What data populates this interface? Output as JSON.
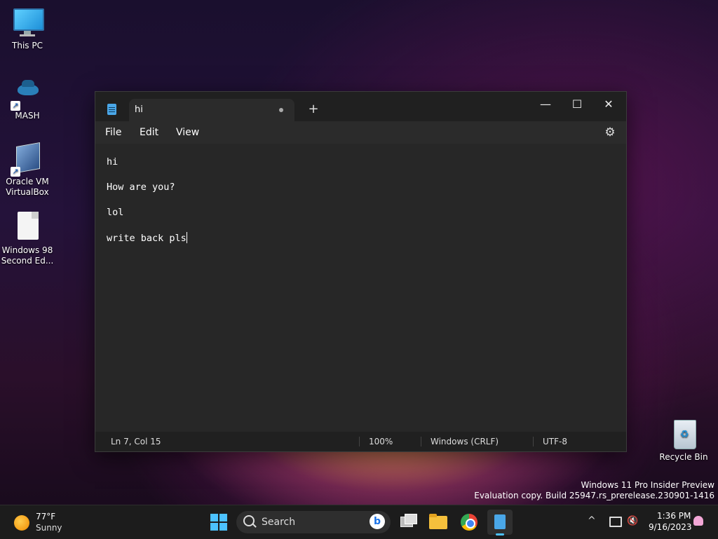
{
  "desktop": {
    "icons": [
      {
        "label": "This PC"
      },
      {
        "label": "MASH"
      },
      {
        "label": "Oracle VM VirtualBox"
      },
      {
        "label": "Windows 98 Second Ed..."
      },
      {
        "label": "Recycle Bin"
      }
    ],
    "watermark": {
      "line1": "Windows 11 Pro Insider Preview",
      "line2": "Evaluation copy. Build 25947.rs_prerelease.230901-1416"
    }
  },
  "notepad": {
    "tab_title": "hi",
    "new_tab_symbol": "+",
    "controls": {
      "minimize": "—",
      "maximize": "☐",
      "close": "✕"
    },
    "menu": {
      "file": "File",
      "edit": "Edit",
      "view": "View"
    },
    "lines": [
      "hi",
      "How are you?",
      "lol",
      "write back pls"
    ],
    "status": {
      "position": "Ln 7, Col 15",
      "zoom": "100%",
      "line_ending": "Windows (CRLF)",
      "encoding": "UTF-8"
    }
  },
  "taskbar": {
    "weather": {
      "temp": "77°F",
      "desc": "Sunny"
    },
    "search_placeholder": "Search",
    "tray_chevron": "^",
    "clock": {
      "time": "1:36 PM",
      "date": "9/16/2023"
    }
  },
  "colors": {
    "accent": "#4cc2ff",
    "window_bg": "#272727",
    "titlebar_bg": "#202020"
  }
}
